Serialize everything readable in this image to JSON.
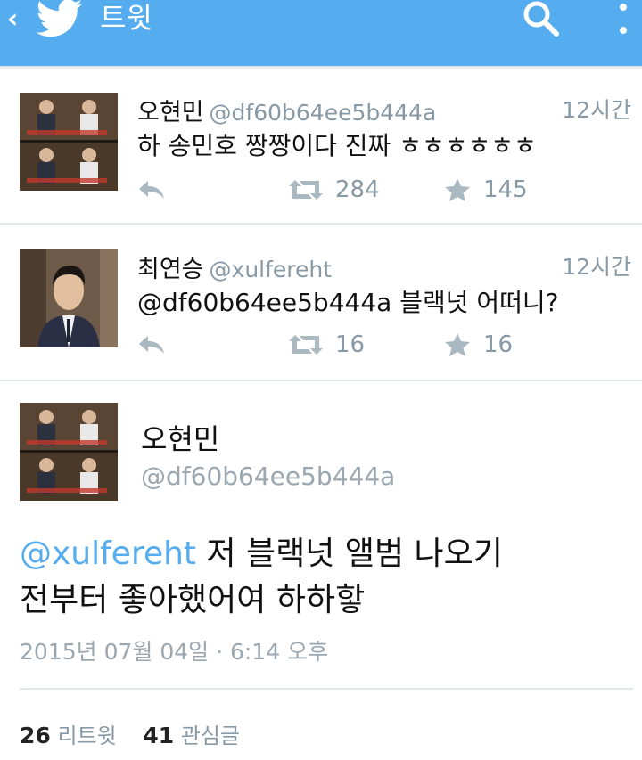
{
  "header": {
    "back_glyph": "‹",
    "title": "트윗",
    "bg_color": "#55acee",
    "icons": [
      "back-icon",
      "twitter-bird-icon",
      "search-icon",
      "more-vertical-icon"
    ]
  },
  "tweets": [
    {
      "name": "오현민",
      "handle": "@df60b64ee5b444a",
      "time": "12시간",
      "text": "하 송민호 짱짱이다 진짜 ㅎㅎㅎㅎㅎㅎ",
      "retweets": "284",
      "favorites": "145"
    },
    {
      "name": "최연승",
      "handle": "@xulfereht",
      "time": "12시간",
      "text": "@df60b64ee5b444a 블랙넛 어떠니?",
      "retweets": "16",
      "favorites": "16"
    }
  ],
  "detail": {
    "name": "오현민",
    "handle": "@df60b64ee5b444a",
    "mention": "@xulfereht",
    "text_line1": " 저 블랙넛 앨범 나오기",
    "text_line2": "전부터 좋아했어여 하하핳",
    "timestamp": "2015년 07월 04일 · 6:14 오후",
    "retweet_count": "26",
    "retweet_label": "리트윗",
    "favorite_count": "41",
    "favorite_label": "관심글"
  },
  "colors": {
    "accent": "#55acee",
    "muted": "#8899a6",
    "divider": "#e1e8ed"
  }
}
